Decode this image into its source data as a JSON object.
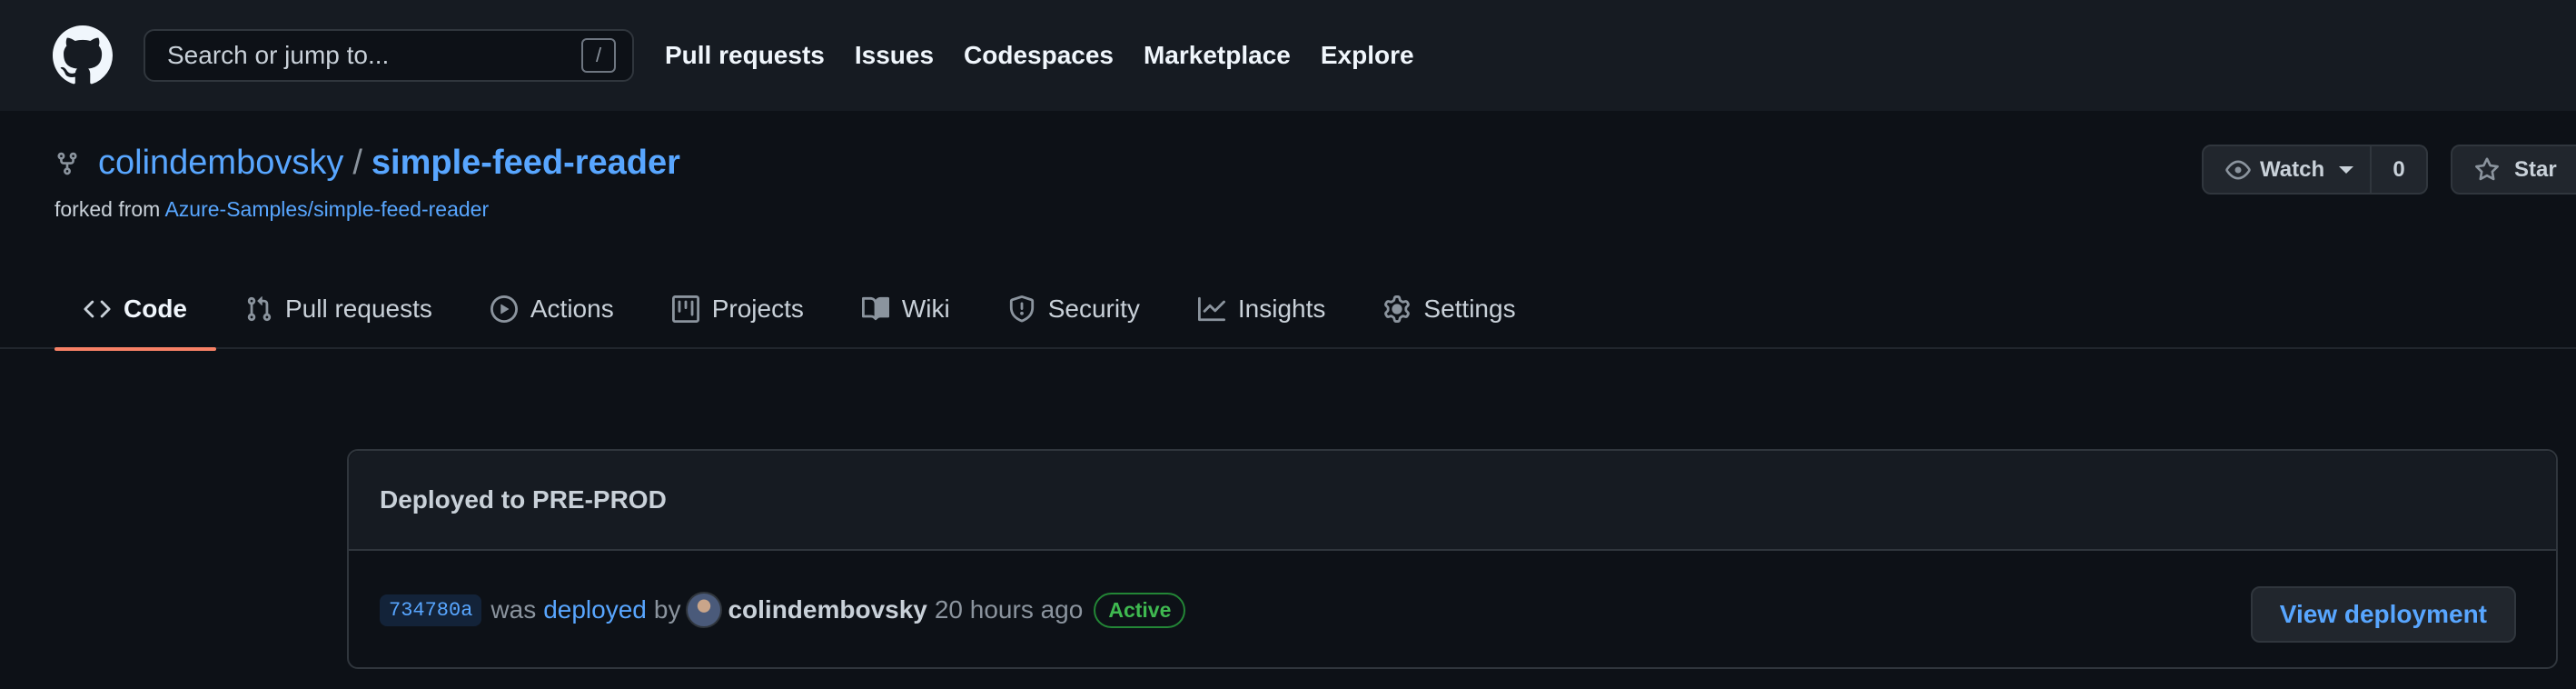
{
  "header": {
    "search_placeholder": "Search or jump to...",
    "search_shortcut": "/",
    "nav": [
      "Pull requests",
      "Issues",
      "Codespaces",
      "Marketplace",
      "Explore"
    ]
  },
  "repo": {
    "owner": "colindembovsky",
    "separator": "/",
    "name": "simple-feed-reader",
    "forked_prefix": "forked from",
    "forked_source": "Azure-Samples/simple-feed-reader",
    "watch_label": "Watch",
    "watch_count": "0",
    "star_label": "Star"
  },
  "tabs": [
    {
      "label": "Code",
      "icon": "code-icon"
    },
    {
      "label": "Pull requests",
      "icon": "pull-request-icon"
    },
    {
      "label": "Actions",
      "icon": "play-icon"
    },
    {
      "label": "Projects",
      "icon": "project-board-icon"
    },
    {
      "label": "Wiki",
      "icon": "book-icon"
    },
    {
      "label": "Security",
      "icon": "shield-icon"
    },
    {
      "label": "Insights",
      "icon": "graph-icon"
    },
    {
      "label": "Settings",
      "icon": "gear-icon"
    }
  ],
  "deployment": {
    "title": "Deployed to PRE-PROD",
    "sha": "734780a",
    "was_text": "was",
    "deployed_text": "deployed",
    "by_text": "by",
    "actor": "colindembovsky",
    "time": "20 hours ago",
    "status": "Active",
    "view_button": "View deployment"
  },
  "colors": {
    "accent_link": "#58a6ff",
    "active_tab_underline": "#f78166",
    "status_green": "#3fb950"
  }
}
